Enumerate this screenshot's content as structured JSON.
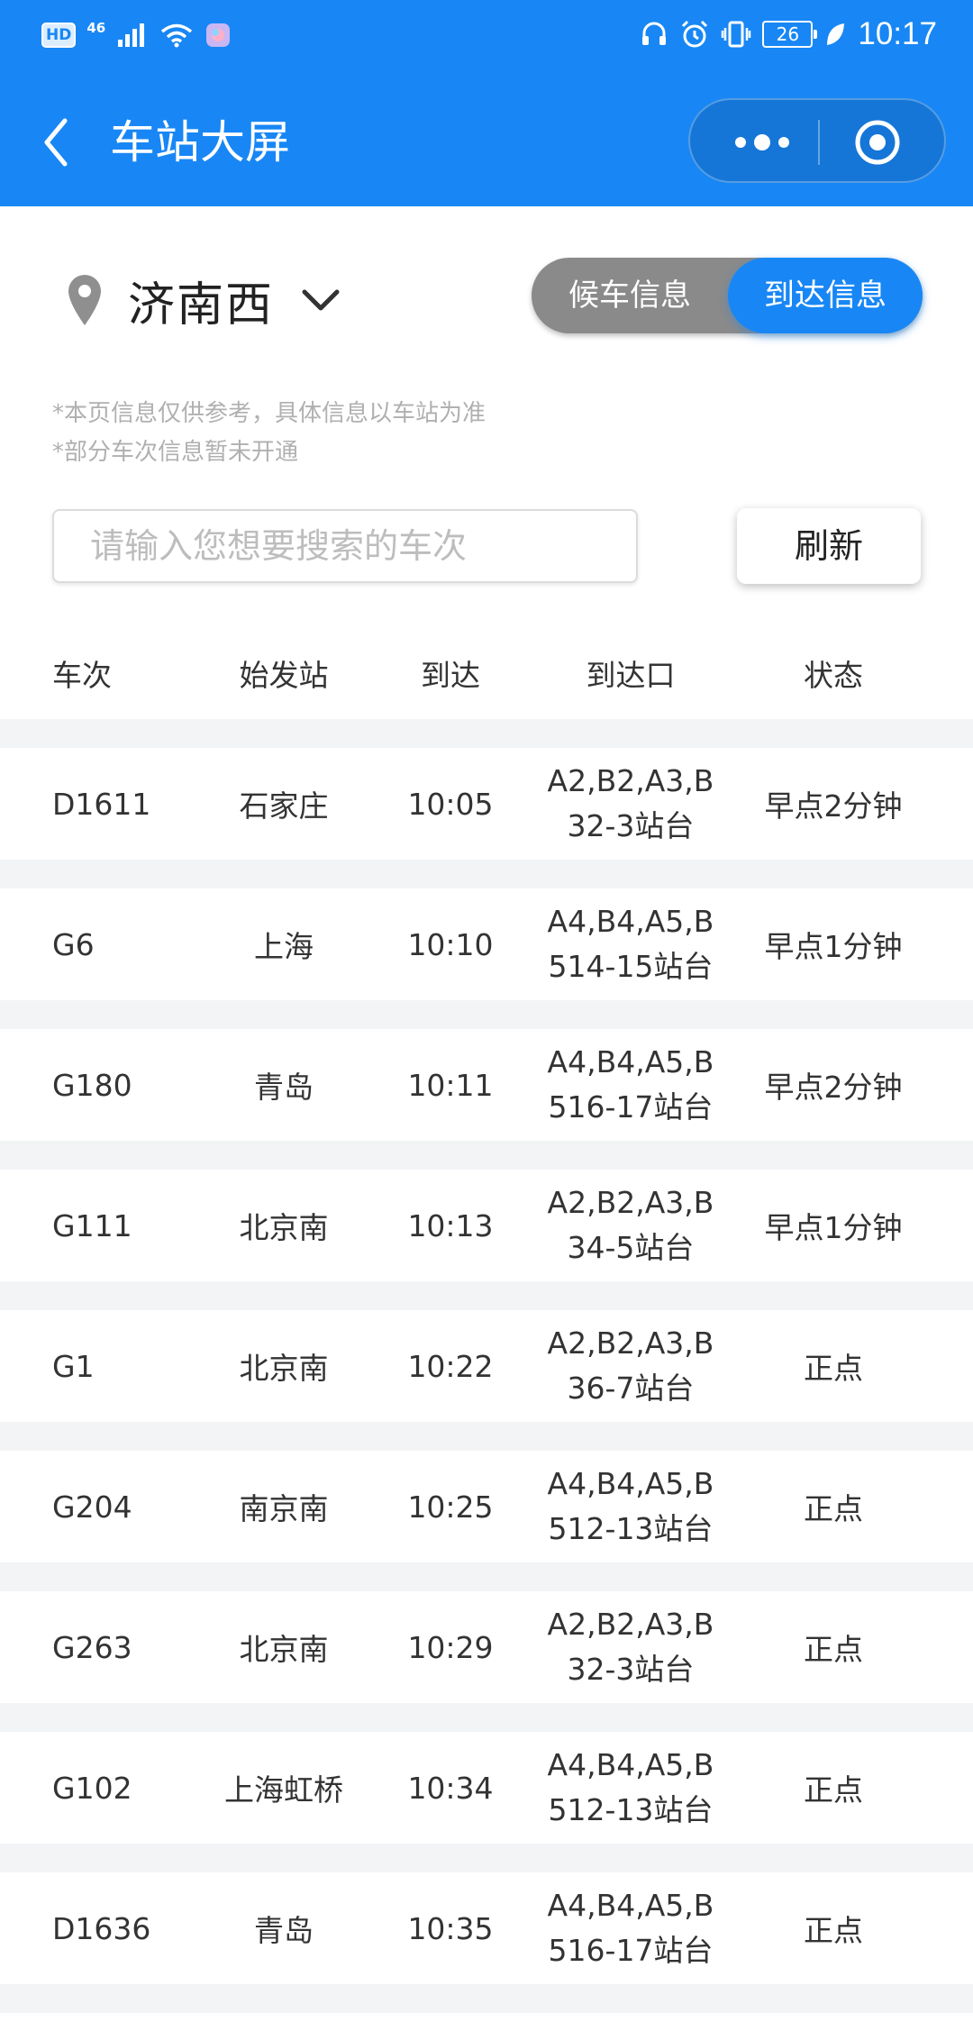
{
  "status_bar": {
    "left_hd": "HD",
    "left_network": "46",
    "battery": "26",
    "time": "10:17"
  },
  "nav": {
    "title": "车站大屏"
  },
  "station": {
    "name": "济南西"
  },
  "toggle": {
    "left": "候车信息",
    "right": "到达信息"
  },
  "notes": [
    "*本页信息仅供参考，具体信息以车站为准",
    "*部分车次信息暂未开通"
  ],
  "search": {
    "placeholder": "请输入您想要搜索的车次",
    "value": ""
  },
  "refresh_label": "刷新",
  "table": {
    "headers": [
      "车次",
      "始发站",
      "到达",
      "到达口",
      "状态"
    ],
    "rows": [
      {
        "train": "D1611",
        "origin": "石家庄",
        "arrive": "10:05",
        "gate_line1": "A2,B2,A3,B",
        "gate_line2": "32-3站台",
        "status": "早点2分钟"
      },
      {
        "train": "G6",
        "origin": "上海",
        "arrive": "10:10",
        "gate_line1": "A4,B4,A5,B",
        "gate_line2": "514-15站台",
        "status": "早点1分钟"
      },
      {
        "train": "G180",
        "origin": "青岛",
        "arrive": "10:11",
        "gate_line1": "A4,B4,A5,B",
        "gate_line2": "516-17站台",
        "status": "早点2分钟"
      },
      {
        "train": "G111",
        "origin": "北京南",
        "arrive": "10:13",
        "gate_line1": "A2,B2,A3,B",
        "gate_line2": "34-5站台",
        "status": "早点1分钟"
      },
      {
        "train": "G1",
        "origin": "北京南",
        "arrive": "10:22",
        "gate_line1": "A2,B2,A3,B",
        "gate_line2": "36-7站台",
        "status": "正点"
      },
      {
        "train": "G204",
        "origin": "南京南",
        "arrive": "10:25",
        "gate_line1": "A4,B4,A5,B",
        "gate_line2": "512-13站台",
        "status": "正点"
      },
      {
        "train": "G263",
        "origin": "北京南",
        "arrive": "10:29",
        "gate_line1": "A2,B2,A3,B",
        "gate_line2": "32-3站台",
        "status": "正点"
      },
      {
        "train": "G102",
        "origin": "上海虹桥",
        "arrive": "10:34",
        "gate_line1": "A4,B4,A5,B",
        "gate_line2": "512-13站台",
        "status": "正点"
      },
      {
        "train": "D1636",
        "origin": "青岛",
        "arrive": "10:35",
        "gate_line1": "A4,B4,A5,B",
        "gate_line2": "516-17站台",
        "status": "正点"
      }
    ]
  },
  "colors": {
    "primary": "#1887f5",
    "toggle_inactive": "#8a8a8a",
    "row_gap": "#f3f4f6"
  }
}
